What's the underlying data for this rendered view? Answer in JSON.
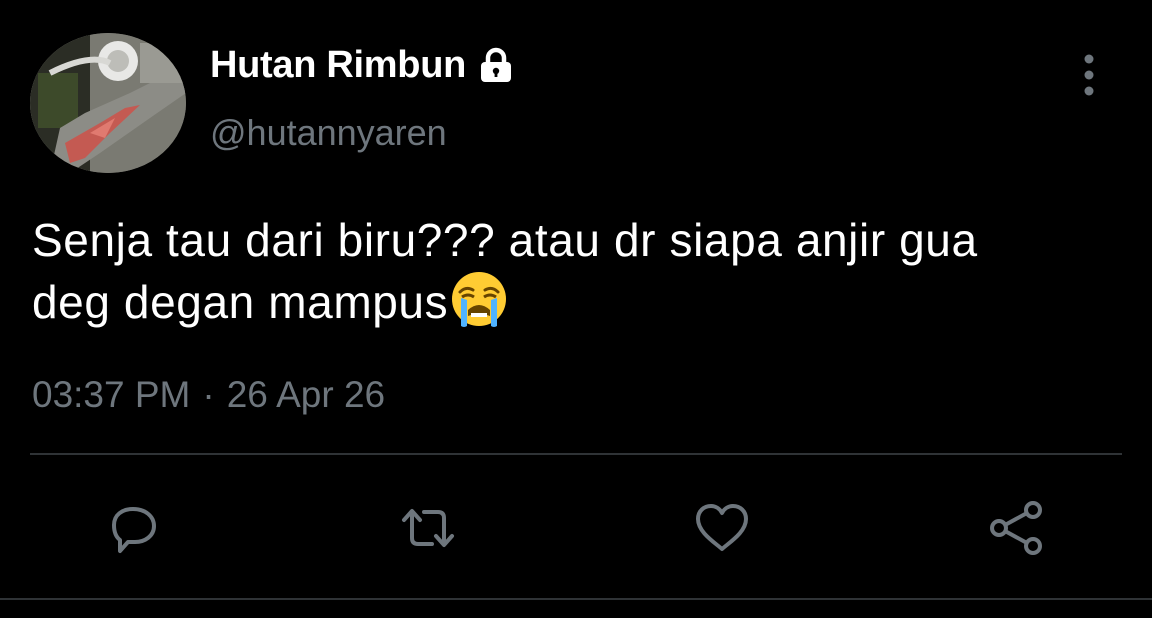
{
  "tweet": {
    "author": {
      "display_name": "Hutan Rimbun",
      "handle": "@hutannyaren",
      "protected_icon": "lock-icon",
      "avatar": "avatar-photo"
    },
    "text_lines": [
      "Senja tau dari biru??? atau dr siapa anjir gua",
      "deg degan mampus"
    ],
    "emoji": "loudly-crying-face-emoji",
    "time": "03:37 PM",
    "separator": "·",
    "date": "26 Apr 26"
  },
  "actions": {
    "reply_icon": "reply-icon",
    "retweet_icon": "retweet-icon",
    "like_icon": "heart-icon",
    "share_icon": "share-icon",
    "more_icon": "more-vertical-icon"
  },
  "colors": {
    "background": "#000000",
    "primary_text": "#ffffff",
    "secondary_text": "#6e767d",
    "divider": "#2f3336"
  }
}
